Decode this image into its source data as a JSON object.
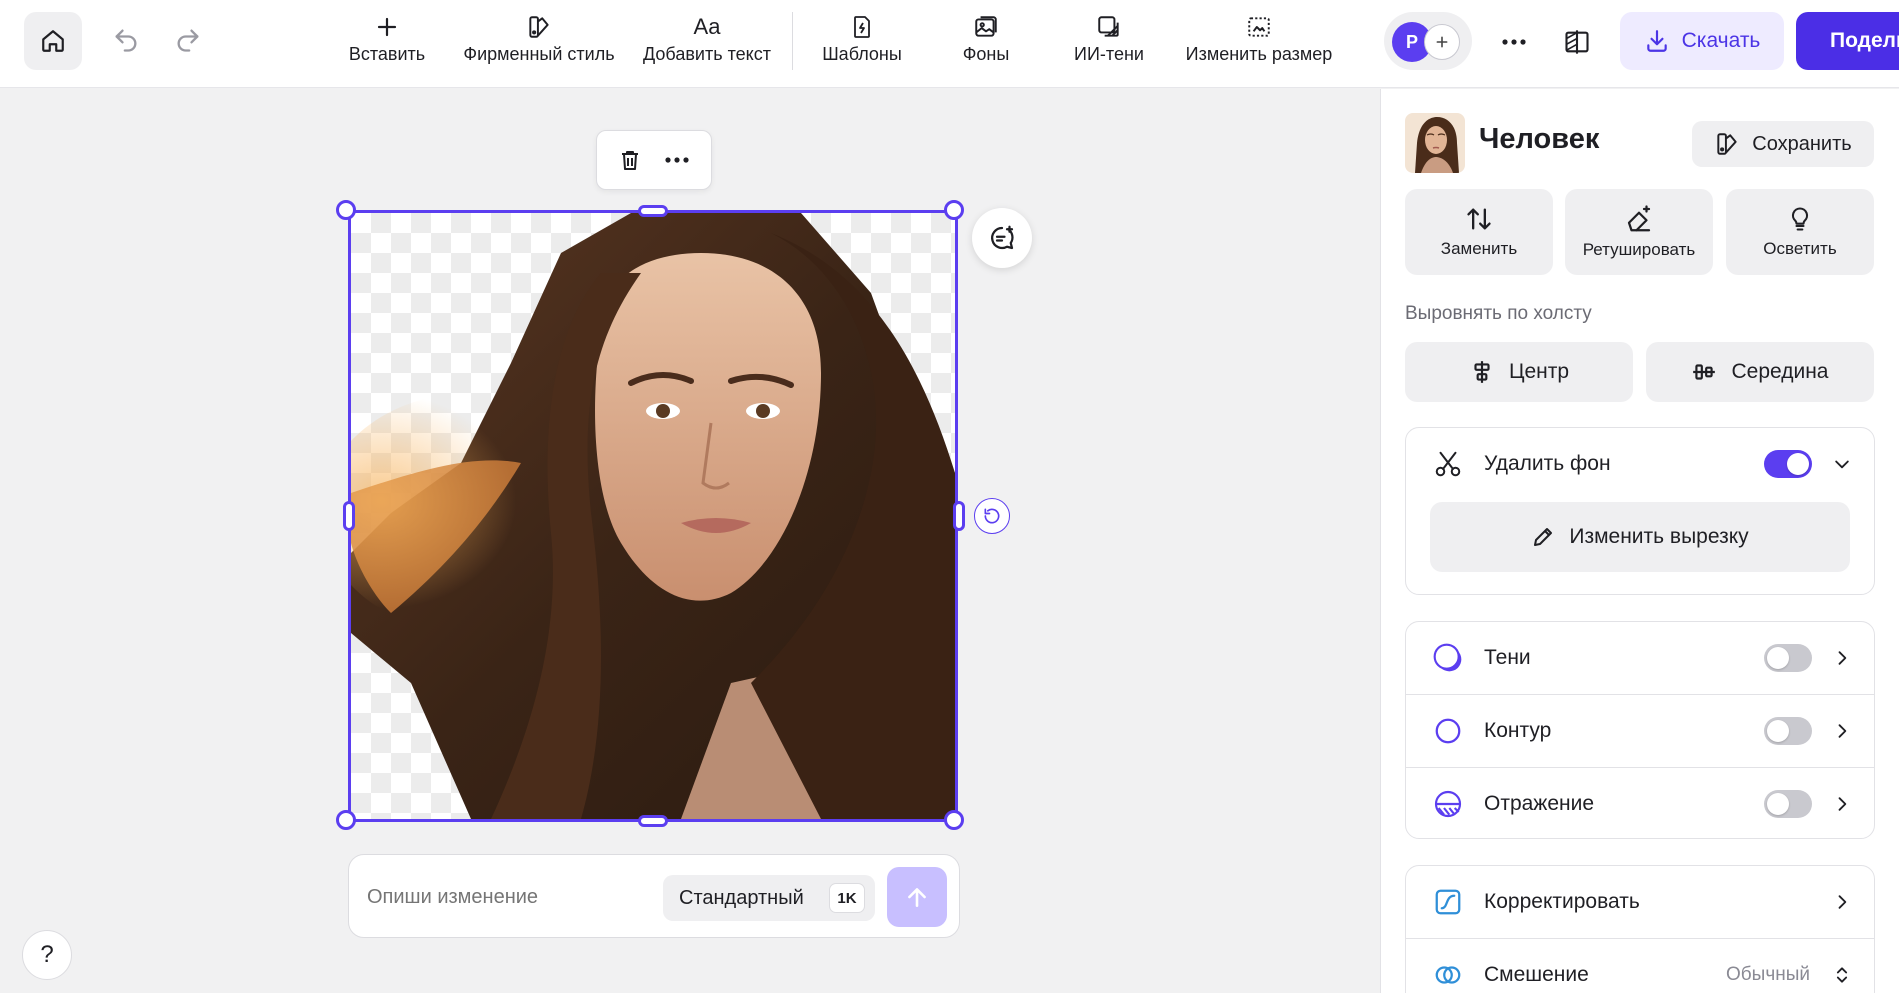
{
  "toolbar": {
    "insert_label": "Вставить",
    "brand_label": "Фирменный стиль",
    "text_label": "Добавить текст",
    "text_icon_glyph": "Aa",
    "templates_label": "Шаблоны",
    "backgrounds_label": "Фоны",
    "ai_shadows_label": "ИИ-тени",
    "resize_label": "Изменить размер",
    "avatar_initial": "P",
    "download_label": "Скачать",
    "share_label": "Поделиться"
  },
  "canvas": {
    "prompt_placeholder": "Опиши изменение",
    "quality_label": "Стандартный",
    "resolution_badge": "1K",
    "help_label": "?"
  },
  "panel": {
    "title": "Человек",
    "save_label": "Сохранить",
    "actions": [
      {
        "label": "Заменить",
        "icon": "swap-icon"
      },
      {
        "label": "Ретушировать",
        "icon": "eraser-sparkle-icon"
      },
      {
        "label": "Осветить",
        "icon": "lightbulb-icon"
      }
    ],
    "align_label": "Выровнять по холсту",
    "align_center_label": "Центр",
    "align_middle_label": "Середина",
    "remove_bg": {
      "label": "Удалить фон",
      "enabled": true,
      "edit_cutout_label": "Изменить вырезку"
    },
    "effects": [
      {
        "label": "Тени",
        "enabled": false
      },
      {
        "label": "Контур",
        "enabled": false
      },
      {
        "label": "Отражение",
        "enabled": false
      }
    ],
    "adjust_label": "Корректировать",
    "blend_label": "Смешение",
    "blend_value": "Обычный"
  },
  "colors": {
    "accent": "#5b3ef0",
    "accent_soft": "#eeebff",
    "surface": "#efeff1"
  }
}
